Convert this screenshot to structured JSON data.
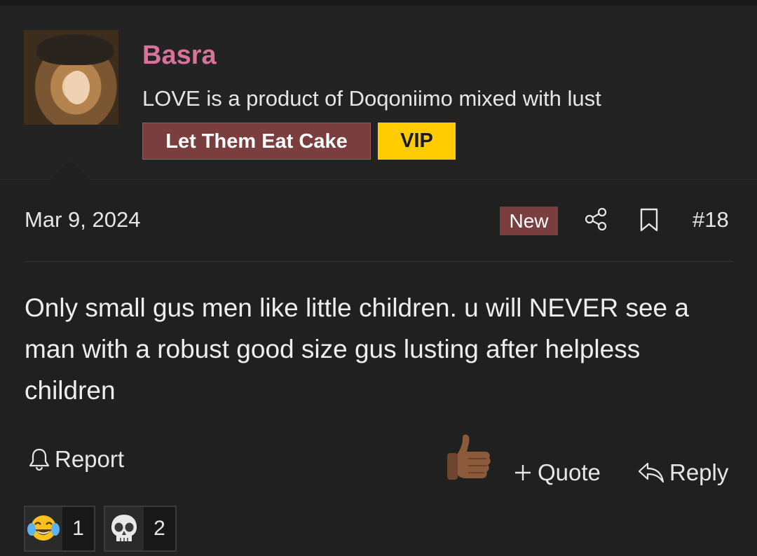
{
  "user": {
    "name": "Basra",
    "tagline": "LOVE is a product of Doqoniimo mixed with lust",
    "badges": [
      {
        "label": "Let Them Eat Cake",
        "color": "#7a3e3e"
      },
      {
        "label": "VIP",
        "color": "#ffcc00"
      }
    ]
  },
  "post": {
    "date": "Mar 9, 2024",
    "new_label": "New",
    "number": "#18",
    "body": "Only small gus men like little children. u will NEVER see a man with a robust good size gus lusting after helpless children"
  },
  "actions": {
    "report": "Report",
    "quote": "Quote",
    "reply": "Reply",
    "like_icon": "thumbs-up-icon"
  },
  "reactions": [
    {
      "icon": "tears-of-joy-icon",
      "count": "1"
    },
    {
      "icon": "skull-icon",
      "count": "2"
    }
  ],
  "colors": {
    "background": "#202020",
    "username": "#d6739a",
    "accent": "#7a3e3e",
    "vip": "#ffcc00"
  }
}
